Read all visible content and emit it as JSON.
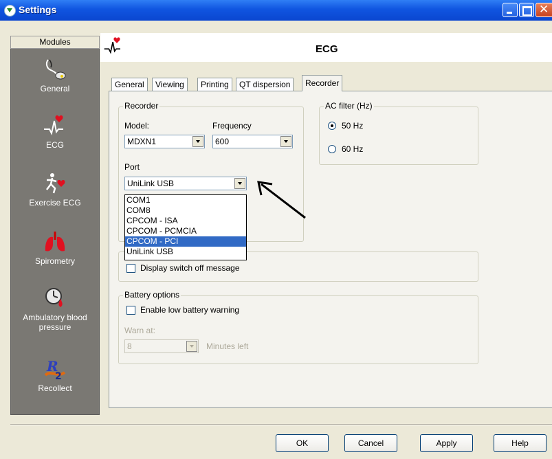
{
  "window": {
    "title": "Settings"
  },
  "sidebar": {
    "header": "Modules",
    "items": [
      {
        "label": "General",
        "icon": "stethoscope-icon"
      },
      {
        "label": "ECG",
        "icon": "ecg-heart-icon"
      },
      {
        "label": "Exercise ECG",
        "icon": "runner-heart-icon"
      },
      {
        "label": "Spirometry",
        "icon": "lungs-icon"
      },
      {
        "label": "Ambulatory blood pressure",
        "label_line1": "Ambulatory blood",
        "label_line2": "pressure",
        "icon": "clock-blood-drop-icon"
      },
      {
        "label": "Recollect",
        "icon": "recollect-icon"
      }
    ]
  },
  "main": {
    "title": "ECG",
    "tabs": [
      "General",
      "Viewing",
      "Printing",
      "QT dispersion",
      "Recorder"
    ],
    "active_tab": "Recorder"
  },
  "recorder": {
    "group_title": "Recorder",
    "model_label": "Model:",
    "model_value": "MDXN1",
    "frequency_label": "Frequency",
    "frequency_value": "600",
    "port_label": "Port",
    "port_value": "UniLink USB",
    "port_options": [
      "COM1",
      "COM8",
      "CPCOM - ISA",
      "CPCOM - PCMCIA",
      "CPCOM - PCI",
      "UniLink USB"
    ],
    "highlighted_option": "CPCOM - PCI"
  },
  "ac_filter": {
    "group_title": "AC filter (Hz)",
    "options": [
      "50 Hz",
      "60 Hz"
    ],
    "selected": "50 Hz"
  },
  "switch_off": {
    "checkbox_label": "Display switch off message",
    "checked": false
  },
  "battery": {
    "group_title": "Battery options",
    "checkbox_label": "Enable low battery warning",
    "checked": false,
    "warn_label": "Warn at:",
    "warn_value": "8",
    "minutes_label": "Minutes left"
  },
  "buttons": {
    "ok": "OK",
    "cancel": "Cancel",
    "apply": "Apply",
    "help": "Help"
  },
  "colors": {
    "titlebar": "#0a46d0",
    "sidebar": "#7a7873",
    "highlight": "#316ac5"
  }
}
